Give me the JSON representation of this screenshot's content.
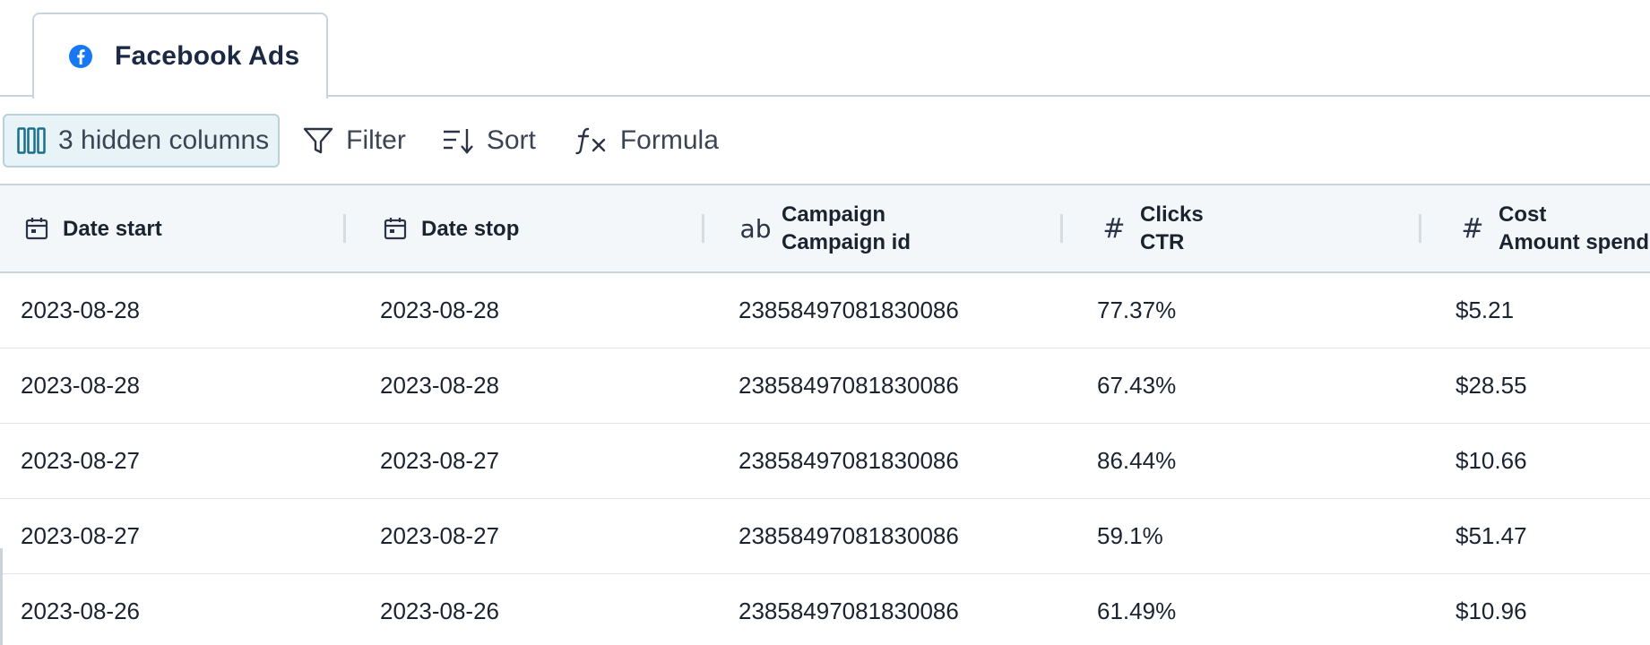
{
  "tabs": [
    {
      "label": "Facebook Ads",
      "icon": "facebook-icon",
      "color": "#1877f2"
    }
  ],
  "toolbar": {
    "hidden_columns_label": "3 hidden columns",
    "filter_label": "Filter",
    "sort_label": "Sort",
    "formula_label": "Formula",
    "accent": "#1a6f8a"
  },
  "table": {
    "columns": [
      {
        "type_icon": "calendar-icon",
        "line1": "Date start",
        "line2": ""
      },
      {
        "type_icon": "calendar-icon",
        "line1": "Date stop",
        "line2": ""
      },
      {
        "type_icon": "text-type-icon",
        "type_glyph": "ab",
        "line1": "Campaign",
        "line2": "Campaign id"
      },
      {
        "type_icon": "number-type-icon",
        "type_glyph": "#",
        "line1": "Clicks",
        "line2": "CTR"
      },
      {
        "type_icon": "number-type-icon",
        "type_glyph": "#",
        "line1": "Cost",
        "line2": "Amount spend"
      }
    ],
    "rows": [
      [
        "2023-08-28",
        "2023-08-28",
        "23858497081830086",
        "77.37%",
        "$5.21"
      ],
      [
        "2023-08-28",
        "2023-08-28",
        "23858497081830086",
        "67.43%",
        "$28.55"
      ],
      [
        "2023-08-27",
        "2023-08-27",
        "23858497081830086",
        "86.44%",
        "$10.66"
      ],
      [
        "2023-08-27",
        "2023-08-27",
        "23858497081830086",
        "59.1%",
        "$51.47"
      ],
      [
        "2023-08-26",
        "2023-08-26",
        "23858497081830086",
        "61.49%",
        "$10.96"
      ]
    ]
  }
}
